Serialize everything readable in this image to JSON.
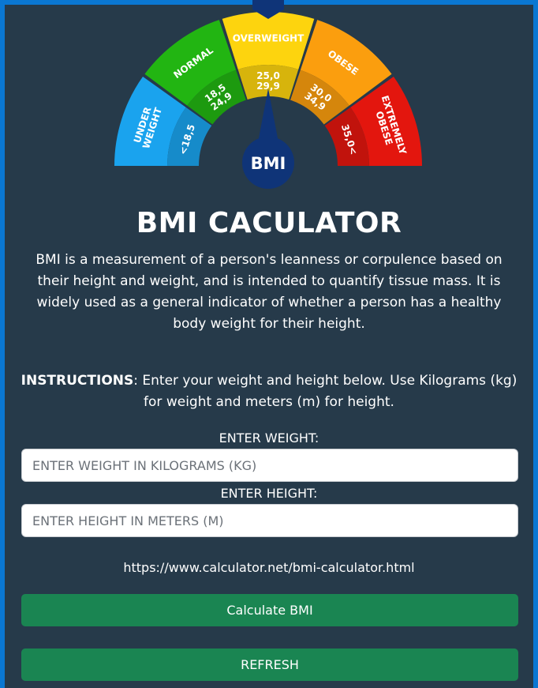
{
  "gauge": {
    "segments": [
      {
        "name": "under-weight",
        "label_lines": [
          "UNDER",
          "WEIGHT"
        ],
        "range_lines": [
          "<18,5"
        ],
        "color": "#1aa3ee"
      },
      {
        "name": "normal",
        "label_lines": [
          "NORMAL"
        ],
        "range_lines": [
          "18,5",
          "24,9"
        ],
        "color": "#22b512"
      },
      {
        "name": "overweight",
        "label_lines": [
          "OVERWEIGHT"
        ],
        "range_lines": [
          "25,0",
          "29,9"
        ],
        "color": "#fdd40e"
      },
      {
        "name": "obese",
        "label_lines": [
          "OBESE"
        ],
        "range_lines": [
          "30,0",
          "34,9"
        ],
        "color": "#fb9e0e"
      },
      {
        "name": "extremely-obese",
        "label_lines": [
          "EXTREMELY",
          "OBESE"
        ],
        "range_lines": [
          "35,0<"
        ],
        "color": "#e3160e"
      }
    ],
    "center_label": "BMI",
    "center_color": "#0f3478"
  },
  "title": "BMI CACULATOR",
  "description": "BMI is a measurement of a person's leanness or corpulence based on their height and weight, and is intended to quantify tissue mass. It is widely used as a general indicator of whether a person has a healthy body weight for their height.",
  "instructions": {
    "label": "INSTRUCTIONS",
    "text": ": Enter your weight and height below. Use Kilograms (kg) for weight and meters (m) for height."
  },
  "weight": {
    "label": "ENTER WEIGHT:",
    "placeholder": "ENTER WEIGHT IN KILOGRAMS (KG)",
    "value": ""
  },
  "height": {
    "label": "ENTER HEIGHT:",
    "placeholder": "ENTER HEIGHT IN METERS (M)",
    "value": ""
  },
  "source_url": "https://www.calculator.net/bmi-calculator.html",
  "buttons": {
    "calculate": "Calculate BMI",
    "refresh": "REFRESH"
  },
  "colors": {
    "background": "#263a4a",
    "accent": "#0a77d2",
    "button": "#1a8552"
  }
}
